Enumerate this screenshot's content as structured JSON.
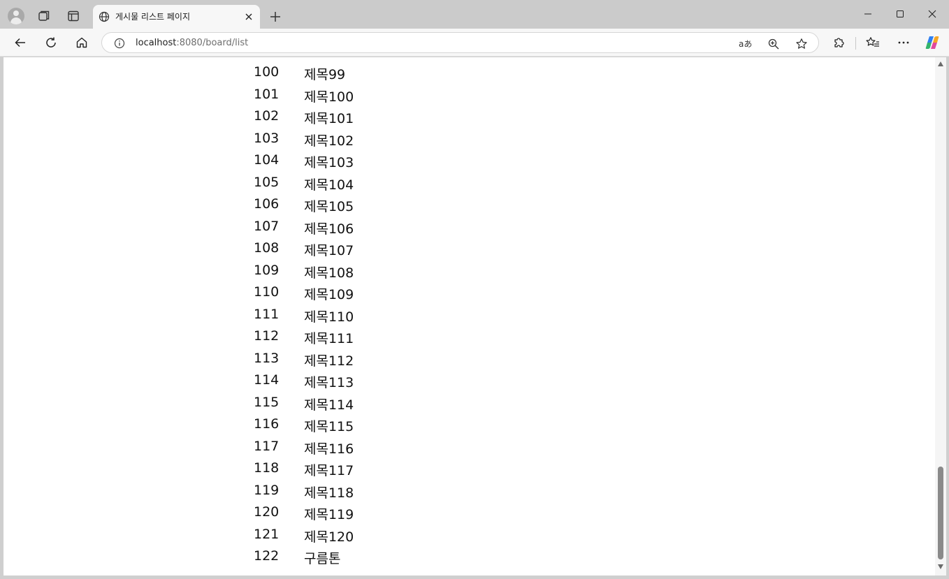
{
  "browser": {
    "tab": {
      "title": "게시물 리스트 페이지"
    },
    "url": {
      "host": "localhost",
      "rest": ":8080/board/list"
    }
  },
  "colors": {
    "tabstrip": "#cbcbcb",
    "toolbar": "#f7f7f7",
    "page": "#ffffff",
    "text": "#111111"
  },
  "icons": [
    "profile-icon",
    "workspaces-icon",
    "tab-actions-icon",
    "globe-icon",
    "close-icon",
    "plus-icon",
    "minimize-icon",
    "maximize-icon",
    "close-window-icon",
    "back-icon",
    "reload-icon",
    "home-icon",
    "info-icon",
    "read-aloud-icon",
    "zoom-icon",
    "favorite-star-icon",
    "extensions-icon",
    "favorites-icon",
    "more-icon",
    "copilot-icon"
  ],
  "board": {
    "rows": [
      {
        "num": "100",
        "subject": "제목99"
      },
      {
        "num": "101",
        "subject": "제목100"
      },
      {
        "num": "102",
        "subject": "제목101"
      },
      {
        "num": "103",
        "subject": "제목102"
      },
      {
        "num": "104",
        "subject": "제목103"
      },
      {
        "num": "105",
        "subject": "제목104"
      },
      {
        "num": "106",
        "subject": "제목105"
      },
      {
        "num": "107",
        "subject": "제목106"
      },
      {
        "num": "108",
        "subject": "제목107"
      },
      {
        "num": "109",
        "subject": "제목108"
      },
      {
        "num": "110",
        "subject": "제목109"
      },
      {
        "num": "111",
        "subject": "제목110"
      },
      {
        "num": "112",
        "subject": "제목111"
      },
      {
        "num": "113",
        "subject": "제목112"
      },
      {
        "num": "114",
        "subject": "제목113"
      },
      {
        "num": "115",
        "subject": "제목114"
      },
      {
        "num": "116",
        "subject": "제목115"
      },
      {
        "num": "117",
        "subject": "제목116"
      },
      {
        "num": "118",
        "subject": "제목117"
      },
      {
        "num": "119",
        "subject": "제목118"
      },
      {
        "num": "120",
        "subject": "제목119"
      },
      {
        "num": "121",
        "subject": "제목120"
      },
      {
        "num": "122",
        "subject": "구름톤"
      }
    ]
  }
}
